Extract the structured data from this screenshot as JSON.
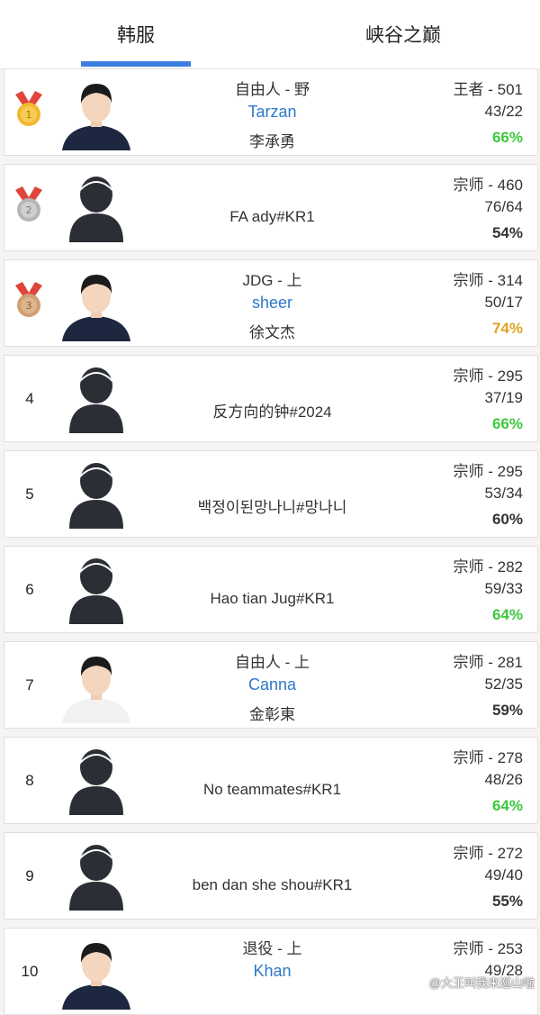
{
  "tabs": [
    {
      "label": "韩服",
      "active": true
    },
    {
      "label": "峡谷之巅",
      "active": false
    }
  ],
  "colors": {
    "accent": "#3d7fe0",
    "name_link": "#2d78c8",
    "winrate_green": "#3ec73e",
    "winrate_gold": "#e3a220",
    "winrate_plain": "#333333"
  },
  "players": [
    {
      "rank": "1",
      "medal": "gold",
      "avatar": "photo-icon",
      "team_role": "自由人 - 野",
      "name": "Tarzan",
      "real_name": "李承勇",
      "tier_lp": "王者 - 501",
      "record": "43/22",
      "winrate": "66%",
      "winrate_color": "green"
    },
    {
      "rank": "2",
      "medal": "silver",
      "avatar": "default-user-icon",
      "account": "FA ady#KR1",
      "tier_lp": "宗师 - 460",
      "record": "76/64",
      "winrate": "54%",
      "winrate_color": "plain"
    },
    {
      "rank": "3",
      "medal": "bronze",
      "avatar": "photo-icon",
      "team_role": "JDG - 上",
      "name": "sheer",
      "real_name": "徐文杰",
      "tier_lp": "宗师 - 314",
      "record": "50/17",
      "winrate": "74%",
      "winrate_color": "gold"
    },
    {
      "rank": "4",
      "avatar": "default-user-icon",
      "account": "反方向的钟#2024",
      "tier_lp": "宗师 - 295",
      "record": "37/19",
      "winrate": "66%",
      "winrate_color": "green"
    },
    {
      "rank": "5",
      "avatar": "default-user-icon",
      "account": "백정이된망나니#망나니",
      "tier_lp": "宗师 - 295",
      "record": "53/34",
      "winrate": "60%",
      "winrate_color": "plain"
    },
    {
      "rank": "6",
      "avatar": "default-user-icon",
      "account": "Hao tian Jug#KR1",
      "tier_lp": "宗师 - 282",
      "record": "59/33",
      "winrate": "64%",
      "winrate_color": "green"
    },
    {
      "rank": "7",
      "avatar": "photo-icon",
      "team_role": "自由人 - 上",
      "name": "Canna",
      "real_name": "金彰東",
      "tier_lp": "宗师 - 281",
      "record": "52/35",
      "winrate": "59%",
      "winrate_color": "plain"
    },
    {
      "rank": "8",
      "avatar": "default-user-icon",
      "account": "No teammates#KR1",
      "tier_lp": "宗师 - 278",
      "record": "48/26",
      "winrate": "64%",
      "winrate_color": "green"
    },
    {
      "rank": "9",
      "avatar": "default-user-icon",
      "account": "ben dan she shou#KR1",
      "tier_lp": "宗师 - 272",
      "record": "49/40",
      "winrate": "55%",
      "winrate_color": "plain"
    },
    {
      "rank": "10",
      "avatar": "photo-icon",
      "team_role": "退役 - 上",
      "name": "Khan",
      "real_name": "",
      "tier_lp": "宗师 - 253",
      "record": "49/28",
      "winrate": "",
      "winrate_color": "plain"
    }
  ],
  "watermark": "@大王叫我来巡山啦"
}
